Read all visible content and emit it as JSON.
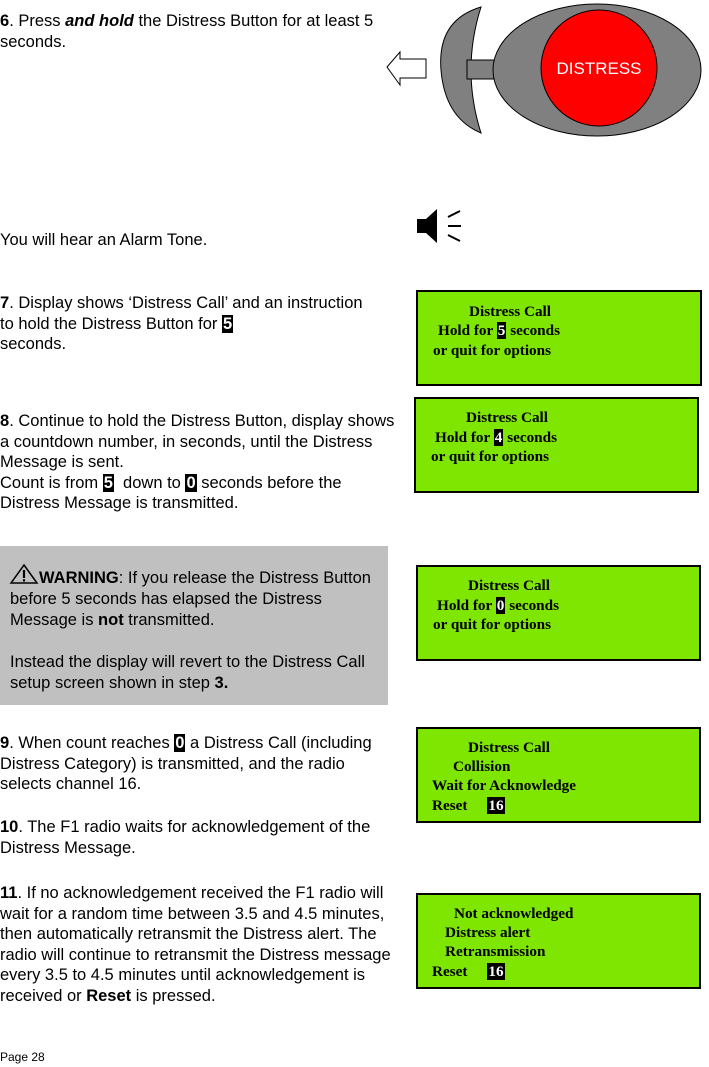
{
  "step6": {
    "num": "6",
    "pre": ". Press ",
    "emph": "and hold",
    "post": " the Distress Button for at least 5 seconds."
  },
  "button_graphic": {
    "label": "DISTRESS",
    "colors": {
      "button": "#ff0000",
      "body": "#808080"
    }
  },
  "alarm": {
    "text": "You will hear an Alarm Tone."
  },
  "step7": {
    "num": "7",
    "pre": ". Display shows ‘Distress Call’ and an instruction to hold the Distress Button for ",
    "hl": "5",
    "post": " seconds."
  },
  "step8": {
    "num": "8",
    "text1": ". Continue to hold the Distress Button, display shows a countdown number, in seconds, until the Distress Message is sent.",
    "count_pre": "Count is from ",
    "hl_from": "5",
    "count_mid": "  down to ",
    "hl_to": "0",
    "count_post": " seconds before the Distress Message is transmitted."
  },
  "warning": {
    "icon": "warning-triangle-icon",
    "label": "WARNING",
    "t1": ": If you release the Distress Button before 5 seconds has elapsed the Distress Message is ",
    "bold": "not",
    "t2": " transmitted.",
    "t3": "Instead the display will revert to the Distress Call setup screen shown in step ",
    "step_ref": "3."
  },
  "step9": {
    "num": "9",
    "pre": ". When count reaches ",
    "hl": "0",
    "post": " a Distress Call (including Distress Category) is transmitted, and the radio selects channel 16."
  },
  "step10": {
    "num": "10",
    "text": ". The F1 radio waits for acknowledgement of the Distress Message."
  },
  "step11": {
    "num": "11",
    "text": ". If no acknowledgement received the F1 radio will wait for a random time between 3.5 and 4.5 minutes, then automatically retransmit the Distress alert. The radio will continue to retransmit the Distress message every 3.5 to 4.5 minutes until acknowledgement is received or ",
    "bold": "Reset",
    "post": " is pressed."
  },
  "lcd_colors": {
    "background": "#7ee600"
  },
  "lcd1": {
    "title": "Distress Call",
    "hold_pre": "Hold for ",
    "count": "5",
    "hold_post": " seconds",
    "line3": "or quit for options"
  },
  "lcd2": {
    "title": "Distress Call",
    "hold_pre": "Hold for ",
    "count": "4",
    "hold_post": " seconds",
    "line3": "or quit for options"
  },
  "lcd3": {
    "title": "Distress Call",
    "hold_pre": "Hold for ",
    "count": "0",
    "hold_post": " seconds",
    "line3": "or quit for options"
  },
  "lcd4": {
    "title": "Distress Call",
    "category": "Collision",
    "status": "Wait for Acknowledge",
    "reset": "Reset",
    "channel": "16"
  },
  "lcd5": {
    "l1": "Not acknowledged",
    "l2": "Distress alert",
    "l3": "Retransmission",
    "reset": "Reset",
    "channel": "16"
  },
  "footer": {
    "page": "Page 28"
  }
}
